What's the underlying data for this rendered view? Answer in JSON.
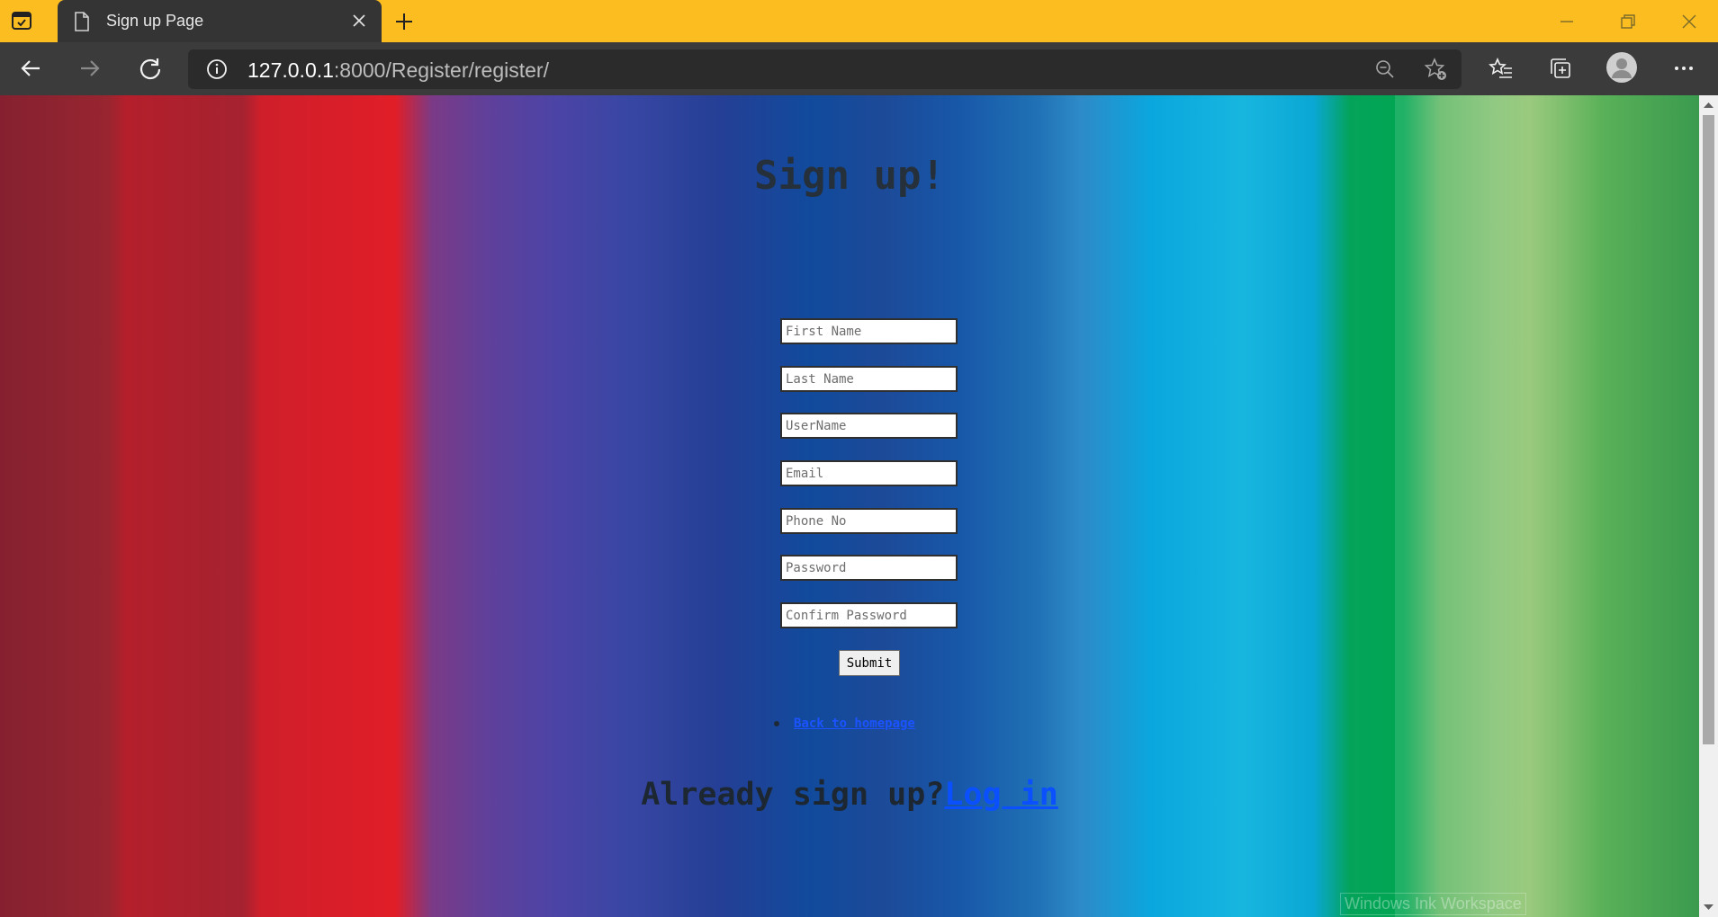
{
  "browser": {
    "tab_title": "Sign up Page",
    "url_host": "127.0.0.1",
    "url_rest": ":8000/Register/register/"
  },
  "page": {
    "heading": "Sign up!",
    "fields": {
      "first_name": "First Name",
      "last_name": "Last Name",
      "username": "UserName",
      "email": "Email",
      "phone": "Phone No",
      "password": "Password",
      "confirm_password": "Confirm Password"
    },
    "submit_label": "Submit",
    "back_link": "Back to homepage",
    "already_text": "Already sign up?",
    "login_link": "Log in"
  },
  "overlay": {
    "ink_workspace": "Windows Ink Workspace"
  }
}
